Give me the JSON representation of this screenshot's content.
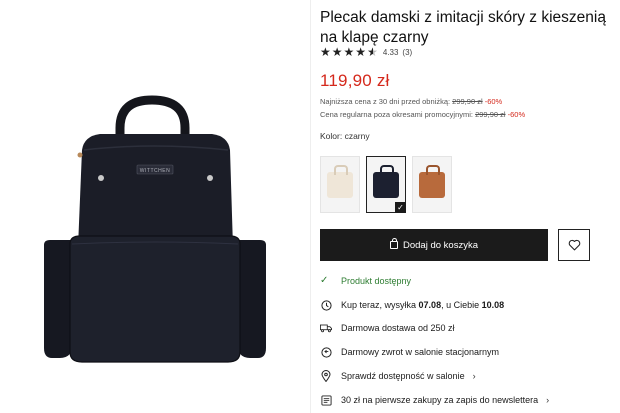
{
  "product": {
    "title": "Plecak damski z imitacji skóry z kieszenią na klapę czarny",
    "image_alt": "Plecak damski czarny",
    "brand_label": "WITTCHEN"
  },
  "rating": {
    "value": "4.33",
    "count": "(3)",
    "stars_filled": 4.33
  },
  "price": {
    "current": "119,90 zł",
    "lowest_label": "Najniższa cena z 30 dni przed obniżką:",
    "lowest_value": "299,90 zł",
    "lowest_discount": "-60%",
    "regular_label": "Cena regularna poza okresami promocyjnymi:",
    "regular_value": "299,90 zł",
    "regular_discount": "-60%"
  },
  "color": {
    "label": "Kolor: czarny",
    "swatches": [
      {
        "name": "beige",
        "color": "#efe6d8",
        "selected": false
      },
      {
        "name": "black",
        "color": "#1c2030",
        "selected": true
      },
      {
        "name": "brown",
        "color": "#b86a3c",
        "selected": false
      }
    ]
  },
  "actions": {
    "add_to_cart": "Dodaj do koszyka"
  },
  "availability": {
    "label": "Produkt dostępny"
  },
  "features": {
    "shipping_prefix": "Kup teraz, wysyłka",
    "shipping_date": "07.08",
    "shipping_mid": ", u Ciebie",
    "delivery_date": "10.08",
    "free_delivery": "Darmowa dostawa od 250 zł",
    "free_return": "Darmowy zwrot w salonie stacjonarnym",
    "check_store": "Sprawdź dostępność w salonie",
    "newsletter": "30 zł na pierwsze zakupy za zapis do newslettera"
  },
  "colors": {
    "accent_red": "#d5291c",
    "available_green": "#2e7d32",
    "button_dark": "#1b1b1b"
  }
}
